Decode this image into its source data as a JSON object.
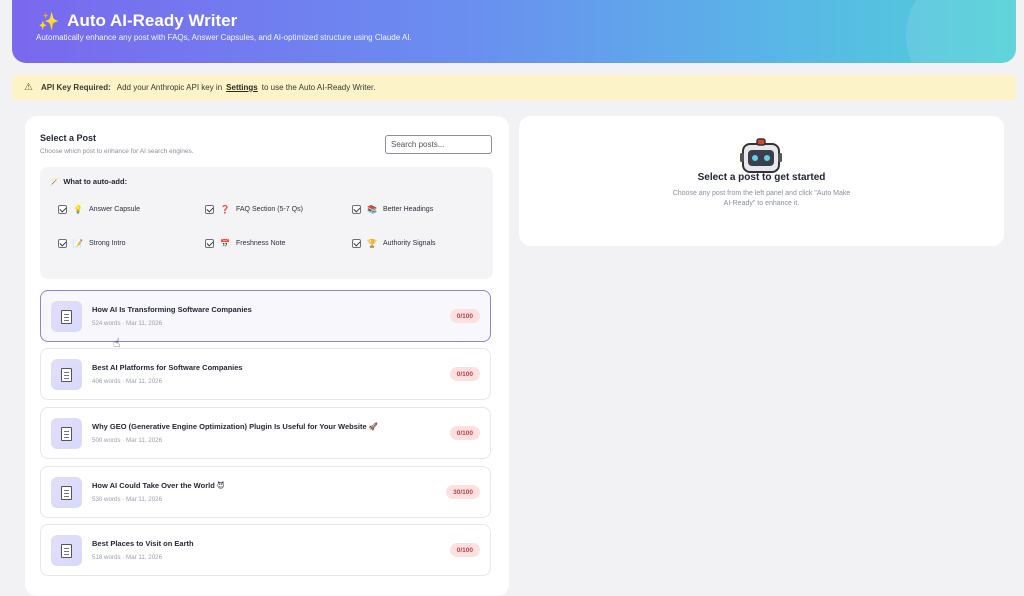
{
  "header": {
    "title": "Auto AI-Ready Writer",
    "subtitle": "Automatically enhance any post with FAQs, Answer Capsules, and AI-optimized structure using Claude AI.",
    "logo_icon": "sparkle-icon"
  },
  "notice": {
    "label": "API Key Required:",
    "text_before": "Add your Anthropic API key in",
    "link": "Settings",
    "text_after": "to use the Auto AI-Ready Writer."
  },
  "left": {
    "title": "Select a Post",
    "subtitle": "Choose which post to enhance for AI search engines.",
    "search_placeholder": "Search posts...",
    "autoadd": {
      "title": "What to auto-add:",
      "options": [
        {
          "label": "Answer Capsule",
          "icon": "💡",
          "checked": true
        },
        {
          "label": "FAQ Section (5-7 Qs)",
          "icon": "❓",
          "checked": true
        },
        {
          "label": "Better Headings",
          "icon": "📚",
          "checked": true
        },
        {
          "label": "Strong Intro",
          "icon": "📝",
          "checked": true
        },
        {
          "label": "Freshness Note",
          "icon": "📅",
          "checked": true
        },
        {
          "label": "Authority Signals",
          "icon": "🏆",
          "checked": true
        }
      ]
    },
    "posts": [
      {
        "title": "How AI Is Transforming Software Companies",
        "meta": "524 words · Mar 11, 2026",
        "score": "0/100"
      },
      {
        "title": "Best AI Platforms for Software Companies",
        "meta": "406 words · Mar 11, 2026",
        "score": "0/100"
      },
      {
        "title": "Why GEO (Generative Engine Optimization) Plugin Is Useful for Your Website 🚀",
        "meta": "500 words · Mar 11, 2026",
        "score": "0/100"
      },
      {
        "title": "How AI Could Take Over the World 😈",
        "meta": "530 words · Mar 11, 2026",
        "score": "30/100"
      },
      {
        "title": "Best Places to Visit on Earth",
        "meta": "518 words · Mar 11, 2026",
        "score": "0/100"
      }
    ]
  },
  "right": {
    "icon": "robot-icon",
    "title": "Select a post to get started",
    "subtitle": "Choose any post from the left panel and click \"Auto Make AI-Ready\" to enhance it."
  }
}
